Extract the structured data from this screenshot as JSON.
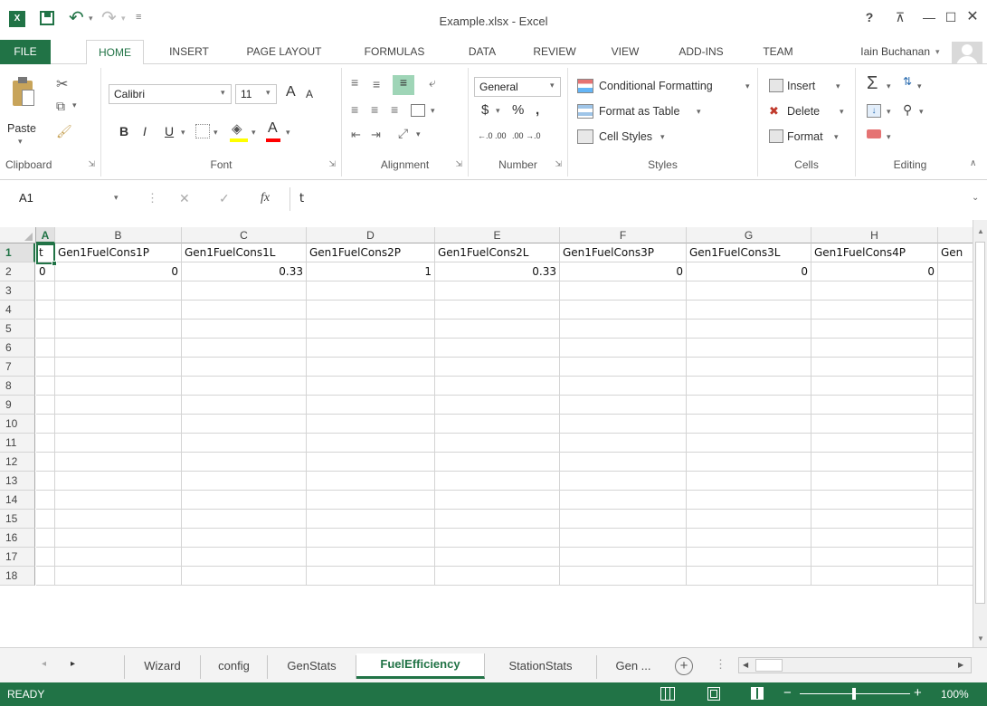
{
  "window": {
    "title": "Example.xlsx - Excel",
    "help": "?",
    "restore_ribbon": "⊼",
    "minimize": "—",
    "maximize": "☐",
    "close": "✕"
  },
  "qat": {
    "save": "save",
    "undo": "undo",
    "redo": "redo"
  },
  "tabs": [
    "FILE",
    "HOME",
    "INSERT",
    "PAGE LAYOUT",
    "FORMULAS",
    "DATA",
    "REVIEW",
    "VIEW",
    "ADD-INS",
    "TEAM"
  ],
  "user": {
    "name": "Iain Buchanan"
  },
  "ribbon": {
    "clipboard": {
      "label": "Clipboard",
      "paste": "Paste"
    },
    "font": {
      "label": "Font",
      "name": "Calibri",
      "size": "11",
      "grow": "A",
      "shrink": "A",
      "bold": "B",
      "italic": "I",
      "underline": "U"
    },
    "alignment": {
      "label": "Alignment"
    },
    "number": {
      "label": "Number",
      "format": "General",
      "currency": "$",
      "percent": "%",
      "comma": ",",
      "inc": "←.0 .00",
      "dec": ".00 →.0"
    },
    "styles": {
      "label": "Styles",
      "conditional": "Conditional Formatting",
      "table": "Format as Table",
      "cell": "Cell Styles"
    },
    "cells": {
      "label": "Cells",
      "insert": "Insert",
      "delete": "Delete",
      "format": "Format"
    },
    "editing": {
      "label": "Editing"
    }
  },
  "formula_bar": {
    "name_box": "A1",
    "fx": "fx",
    "content": "t"
  },
  "grid": {
    "columns": [
      "A",
      "B",
      "C",
      "D",
      "E",
      "F",
      "G",
      "H"
    ],
    "row_numbers": [
      "1",
      "2",
      "3",
      "4",
      "5",
      "6",
      "7",
      "8",
      "9",
      "10",
      "11",
      "12",
      "13",
      "14",
      "15",
      "16",
      "17",
      "18"
    ],
    "row1": [
      "t",
      "Gen1FuelCons1P",
      "Gen1FuelCons1L",
      "Gen1FuelCons2P",
      "Gen1FuelCons2L",
      "Gen1FuelCons3P",
      "Gen1FuelCons3L",
      "Gen1FuelCons4P",
      "Gen"
    ],
    "row2": [
      "0",
      "0",
      "0.33",
      "1",
      "0.33",
      "0",
      "0",
      "0"
    ]
  },
  "sheets": {
    "tabs": [
      "Wizard",
      "config",
      "GenStats",
      "FuelEfficiency",
      "StationStats",
      "Gen ..."
    ],
    "active": "FuelEfficiency"
  },
  "status": {
    "ready": "READY",
    "zoom": "100%"
  },
  "colors": {
    "accent": "#217346",
    "selection": "#217346"
  }
}
